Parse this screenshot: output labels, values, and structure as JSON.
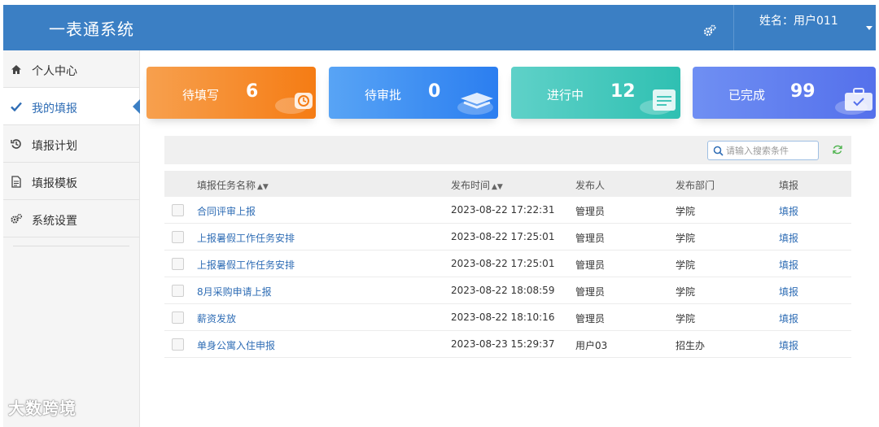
{
  "header": {
    "brand": "一表通系统",
    "user_label": "姓名：用户011"
  },
  "sidebar": {
    "items": [
      {
        "label": "个人中心",
        "icon": "home-icon"
      },
      {
        "label": "我的填报",
        "icon": "check-icon",
        "active": true
      },
      {
        "label": "填报计划",
        "icon": "history-icon"
      },
      {
        "label": "填报模板",
        "icon": "document-icon"
      },
      {
        "label": "系统设置",
        "icon": "gears-icon"
      }
    ],
    "watermark": "大数跨境"
  },
  "cards": [
    {
      "label": "待填写",
      "count": "6",
      "color": "#f57c14",
      "icon": "clock-icon"
    },
    {
      "label": "待审批",
      "count": "0",
      "color": "#2b7ef0",
      "icon": "layers-icon"
    },
    {
      "label": "进行中",
      "count": "12",
      "color": "#2fc0b2",
      "icon": "form-icon"
    },
    {
      "label": "已完成",
      "count": "99",
      "color": "#5470eb",
      "icon": "briefcase-icon"
    }
  ],
  "toolbar": {
    "search_placeholder": "请输入搜索条件"
  },
  "table": {
    "columns": [
      "填报任务名称",
      "发布时间",
      "发布人",
      "发布部门",
      "填报"
    ],
    "rows": [
      {
        "name": "合同评审上报",
        "time": "2023-08-22 17:22:31",
        "publisher": "管理员",
        "dept": "学院",
        "action": "填报"
      },
      {
        "name": "上报暑假工作任务安排",
        "time": "2023-08-22 17:25:01",
        "publisher": "管理员",
        "dept": "学院",
        "action": "填报"
      },
      {
        "name": "上报暑假工作任务安排",
        "time": "2023-08-22 17:25:01",
        "publisher": "管理员",
        "dept": "学院",
        "action": "填报"
      },
      {
        "name": "8月采购申请上报",
        "time": "2023-08-22 18:08:59",
        "publisher": "管理员",
        "dept": "学院",
        "action": "填报"
      },
      {
        "name": "薪资发放",
        "time": "2023-08-22 18:10:16",
        "publisher": "管理员",
        "dept": "学院",
        "action": "填报"
      },
      {
        "name": "单身公寓入住申报",
        "time": "2023-08-23 15:29:37",
        "publisher": "用户03",
        "dept": "招生办",
        "action": "填报"
      }
    ]
  }
}
